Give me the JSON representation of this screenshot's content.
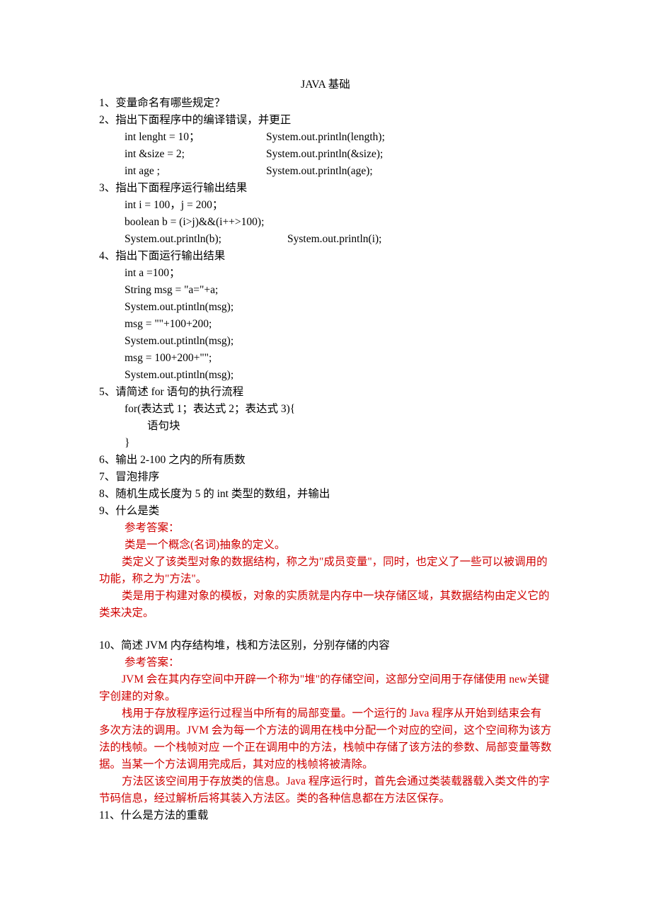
{
  "title": "JAVA 基础",
  "q1": "1、变量命名有哪些规定？",
  "q2": "2、指出下面程序中的编译错误，并更正",
  "q2_l1a": "int    lenght = 10；",
  "q2_l1b": "System.out.println(length);",
  "q2_l2a": "int    &size = 2;",
  "q2_l2b": "System.out.println(&size);",
  "q2_l3a": "int    age ;",
  "q2_l3b": "System.out.println(age);",
  "q3": "3、指出下面程序运行输出结果",
  "q3_l1": "int i = 100，j = 200；",
  "q3_l2": " boolean    b = (i>j)&&(i++>100);",
  "q3_l3a": " System.out.println(b);",
  "q3_l3b": "System.out.println(i);",
  "q4": "4、指出下面运行输出结果",
  "q4_l1": " int a =100；",
  "q4_l2": " String msg = \"a=\"+a;",
  "q4_l3": " System.out.ptintln(msg);",
  "q4_l4": " msg = \"\"+100+200;",
  "q4_l5": " System.out.ptintln(msg);",
  "q4_l6": " msg = 100+200+\"\";",
  "q4_l7": " System.out.ptintln(msg);",
  "q5": "5、请简述 for 语句的执行流程",
  "q5_l1": " for(表达式 1；表达式 2；表达式 3){",
  "q5_l2": "语句块",
  "q5_l3": " }",
  "q6": "6、输出 2-100 之内的所有质数",
  "q7": "7、冒泡排序",
  "q8": "8、随机生成长度为 5 的 int 类型的数组，并输出",
  "q9": "9、什么是类",
  "ans_label": "参考答案：",
  "q9_a1": "类是一个概念(名词)抽象的定义。",
  "q9_a2": "类定义了该类型对象的数据结构，称之为\"成员变量\"，同时，也定义了一些可以被调用的功能，称之为\"方法\"。",
  "q9_a3": "类是用于构建对象的模板，对象的实质就是内存中一块存储区域，其数据结构由定义它的类来决定。",
  "q10": "10、简述 JVM 内存结构堆，栈和方法区别，分别存储的内容",
  "q10_a1": "JVM 会在其内存空间中开辟一个称为\"堆\"的存储空间，这部分空间用于存储使用 new关键字创建的对象。",
  "q10_a2": "栈用于存放程序运行过程当中所有的局部变量。一个运行的 Java 程序从开始到结束会有多次方法的调用。JVM 会为每一个方法的调用在栈中分配一个对应的空间，这个空间称为该方法的栈帧。一个栈帧对应     一个正在调用中的方法，栈帧中存储了该方法的参数、局部变量等数据。当某一个方法调用完成后，其对应的栈帧将被清除。",
  "q10_a3": "方法区该空间用于存放类的信息。Java 程序运行时，首先会通过类装载器载入类文件的字节码信息，经过解析后将其装入方法区。类的各种信息都在方法区保存。",
  "q11": "11、什么是方法的重载"
}
